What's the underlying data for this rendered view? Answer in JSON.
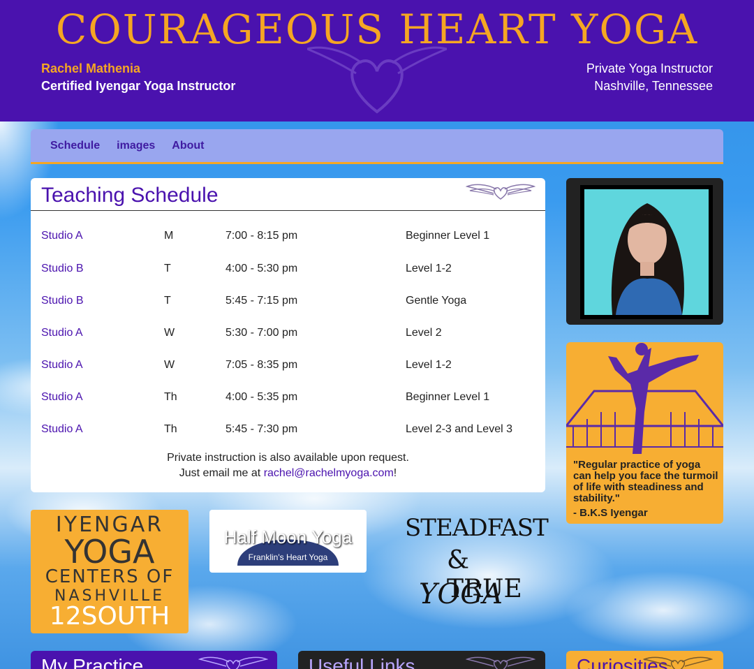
{
  "header": {
    "title": "COURAGEOUS HEART YOGA",
    "name": "Rachel Mathenia",
    "certification": "Certified Iyengar Yoga Instructor",
    "role": "Private Yoga Instructor",
    "location": "Nashville, Tennessee"
  },
  "nav": {
    "items": [
      {
        "label": "Schedule"
      },
      {
        "label": "images"
      },
      {
        "label": "About"
      }
    ]
  },
  "schedule": {
    "title": "Teaching Schedule",
    "rows": [
      {
        "studio": "Studio A",
        "day": "M",
        "time": "7:00 - 8:15 pm",
        "class": "Beginner Level 1"
      },
      {
        "studio": "Studio B",
        "day": "T",
        "time": "4:00 - 5:30 pm",
        "class": "Level 1-2"
      },
      {
        "studio": "Studio B",
        "day": "T",
        "time": "5:45 - 7:15 pm",
        "class": "Gentle Yoga"
      },
      {
        "studio": "Studio A",
        "day": "W",
        "time": "5:30 - 7:00 pm",
        "class": "Level 2"
      },
      {
        "studio": "Studio A",
        "day": "W",
        "time": "7:05 - 8:35 pm",
        "class": "Level 1-2"
      },
      {
        "studio": "Studio A",
        "day": "Th",
        "time": "4:00 - 5:35 pm",
        "class": "Beginner Level 1"
      },
      {
        "studio": "Studio A",
        "day": "Th",
        "time": "5:45 - 7:30 pm",
        "class": "Level 2-3 and Level 3"
      }
    ],
    "private_line": "Private instruction is also available upon request.",
    "email_prefix": "Just email me at ",
    "email": "rachel@rachelmyoga.com",
    "email_suffix": "!"
  },
  "quote": {
    "text": "\"Regular practice of yoga can help you face the turmoil of life with steadiness and stability.\"",
    "author": "- B.K.S Iyengar"
  },
  "logos": {
    "iyengar": {
      "line1": "IYENGAR",
      "line2": "YOGA",
      "line3": "CENTERS OF",
      "line4": "NASHVILLE",
      "line5": "12SOUTH"
    },
    "halfmoon": {
      "title": "Half Moon Yoga",
      "subtitle": "Franklin's Heart Yoga"
    },
    "steadfast": {
      "line1": "STEADFAST",
      "line2": "& TRUE",
      "line3": "YOGA"
    }
  },
  "bottom_cards": [
    {
      "title": "My Practice"
    },
    {
      "title": "Useful Links"
    },
    {
      "title": "Curiosities"
    }
  ],
  "colors": {
    "header_bg": "#4a12ae",
    "accent_orange": "#f5a623",
    "nav_bg": "#99a6ef",
    "link_purple": "#4a12ae"
  }
}
